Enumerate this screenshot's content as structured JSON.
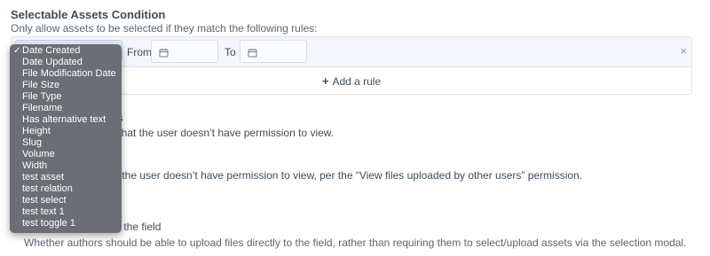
{
  "section": {
    "title": "Selectable Assets Condition",
    "description": "Only allow assets to be selected if they match the following rules:"
  },
  "rule": {
    "from_label": "From",
    "to_label": "To",
    "remove_glyph": "×"
  },
  "add_rule": {
    "plus": "+",
    "label": "Add a rule"
  },
  "background_fragments": {
    "line1": "es",
    "line2": "s that the user doesn’t have permission to view.",
    "line3": "at the user doesn’t have permission to view, per the “View files uploaded by other users” permission.",
    "line4": "s",
    "line5": "to the field",
    "line6": "Whether authors should be able to upload files directly to the field, rather than requiring them to select/upload assets via the selection modal."
  },
  "dropdown": {
    "check_glyph": "✓",
    "options": [
      "Date Created",
      "Date Updated",
      "File Modification Date",
      "File Size",
      "File Type",
      "Filename",
      "Has alternative text",
      "Height",
      "Slug",
      "Volume",
      "Width",
      "test asset",
      "test relation",
      "test select",
      "test text 1",
      "test toggle 1"
    ],
    "selected_index": 0
  },
  "colors": {
    "dropdown_bg": "#6b6e74",
    "rule_row_bg": "#f3f7fc",
    "text": "#3f4d5a"
  }
}
